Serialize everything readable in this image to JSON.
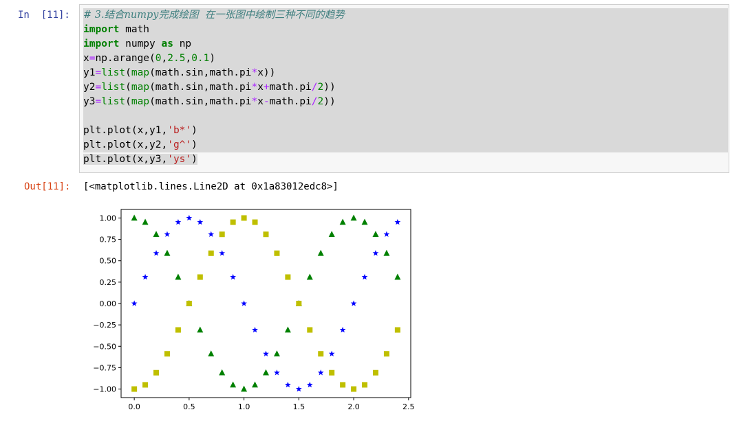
{
  "cell": {
    "in_prompt": "In  [11]:",
    "out_prompt": "Out[11]:",
    "output_text": "[<matplotlib.lines.Line2D at 0x1a83012edc8>]"
  },
  "code": {
    "comment": "# 3.结合numpy完成绘图  在一张图中绘制三种不同的趋势",
    "l2_kw": "import",
    "l2_rest": " math",
    "l3_kw1": "import",
    "l3_mid": " numpy ",
    "l3_kw2": "as",
    "l3_rest": " np",
    "l4_a": "x",
    "l4_eq": "=",
    "l4_b": "np.arange(",
    "l4_n1": "0",
    "l4_c1": ",",
    "l4_n2": "2.5",
    "l4_c2": ",",
    "l4_n3": "0.1",
    "l4_end": ")",
    "l5_a": "y1",
    "l5_eq": "=",
    "l5_list": "list",
    "l5_p": "(",
    "l5_map": "map",
    "l5_b": "(math.sin,math.pi",
    "l5_op": "*",
    "l5_c": "x))",
    "l6_a": "y2",
    "l6_eq": "=",
    "l6_list": "list",
    "l6_p": "(",
    "l6_map": "map",
    "l6_b": "(math.sin,math.pi",
    "l6_op": "*",
    "l6_c": "x",
    "l6_op2": "+",
    "l6_d": "math.pi",
    "l6_op3": "/",
    "l6_n": "2",
    "l6_e": "))",
    "l7_a": "y3",
    "l7_eq": "=",
    "l7_list": "list",
    "l7_p": "(",
    "l7_map": "map",
    "l7_b": "(math.sin,math.pi",
    "l7_op": "*",
    "l7_c": "x",
    "l7_op2": "-",
    "l7_d": "math.pi",
    "l7_op3": "/",
    "l7_n": "2",
    "l7_e": "))",
    "l9_a": "plt.plot(x,y1,",
    "l9_s": "'b*'",
    "l9_e": ")",
    "l10_a": "plt.plot(x,y2,",
    "l10_s": "'g^'",
    "l10_e": ")",
    "l11_a": "plt.plot(x,y3,",
    "l11_s": "'ys'",
    "l11_e": ")"
  },
  "chart_data": {
    "type": "scatter",
    "title": "",
    "xlabel": "",
    "ylabel": "",
    "xlim": [
      -0.12,
      2.52
    ],
    "ylim": [
      -1.1,
      1.1
    ],
    "xticks": [
      "0.0",
      "0.5",
      "1.0",
      "1.5",
      "2.0",
      "2.5"
    ],
    "yticks": [
      "1.00",
      "0.75",
      "0.50",
      "0.25",
      "0.00",
      "−0.25",
      "−0.50",
      "−0.75",
      "−1.00"
    ],
    "ytick_values": [
      1.0,
      0.75,
      0.5,
      0.25,
      0.0,
      -0.25,
      -0.5,
      -0.75,
      -1.0
    ],
    "xtick_values": [
      0.0,
      0.5,
      1.0,
      1.5,
      2.0,
      2.5
    ],
    "x": [
      0.0,
      0.1,
      0.2,
      0.3,
      0.4,
      0.5,
      0.6,
      0.7,
      0.8,
      0.9,
      1.0,
      1.1,
      1.2,
      1.3,
      1.4,
      1.5,
      1.6,
      1.7,
      1.8,
      1.9,
      2.0,
      2.1,
      2.2,
      2.3,
      2.4
    ],
    "series": [
      {
        "marker": "star",
        "color": "#0000ff",
        "values": [
          0.0,
          0.309,
          0.588,
          0.809,
          0.951,
          1.0,
          0.951,
          0.809,
          0.588,
          0.309,
          0.0,
          -0.309,
          -0.588,
          -0.809,
          -0.951,
          -1.0,
          -0.951,
          -0.809,
          -0.588,
          -0.309,
          0.0,
          0.309,
          0.588,
          0.809,
          0.951
        ]
      },
      {
        "marker": "triangle",
        "color": "#008000",
        "values": [
          1.0,
          0.951,
          0.809,
          0.588,
          0.309,
          0.0,
          -0.309,
          -0.588,
          -0.809,
          -0.951,
          -1.0,
          -0.951,
          -0.809,
          -0.588,
          -0.309,
          0.0,
          0.309,
          0.588,
          0.809,
          0.951,
          1.0,
          0.951,
          0.809,
          0.588,
          0.309
        ]
      },
      {
        "marker": "square",
        "color": "#bfbf00",
        "values": [
          -1.0,
          -0.951,
          -0.809,
          -0.588,
          -0.309,
          0.0,
          0.309,
          0.588,
          0.809,
          0.951,
          1.0,
          0.951,
          0.809,
          0.588,
          0.309,
          0.0,
          -0.309,
          -0.588,
          -0.809,
          -0.951,
          -1.0,
          -0.951,
          -0.809,
          -0.588,
          -0.309
        ]
      }
    ]
  }
}
